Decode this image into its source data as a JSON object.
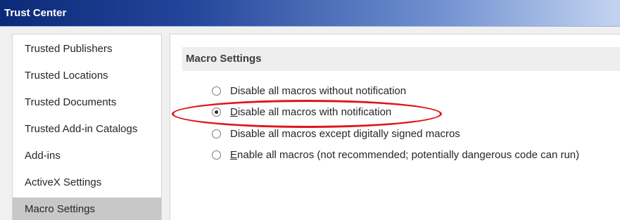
{
  "window": {
    "title": "Trust Center"
  },
  "sidebar": {
    "items": [
      {
        "label": "Trusted Publishers",
        "selected": false
      },
      {
        "label": "Trusted Locations",
        "selected": false
      },
      {
        "label": "Trusted Documents",
        "selected": false
      },
      {
        "label": "Trusted Add-in Catalogs",
        "selected": false
      },
      {
        "label": "Add-ins",
        "selected": false
      },
      {
        "label": "ActiveX Settings",
        "selected": false
      },
      {
        "label": "Macro Settings",
        "selected": true
      }
    ]
  },
  "main": {
    "section_title": "Macro Settings",
    "options": [
      {
        "access_key": "",
        "label_underlined": "",
        "label_rest": "Disable all macros without notification",
        "checked": false
      },
      {
        "access_key": "D",
        "label_underlined": "D",
        "label_rest": "isable all macros with notification",
        "checked": true
      },
      {
        "access_key": "",
        "label_underlined": "",
        "label_rest": "Disable all macros except digitally signed macros",
        "checked": false
      },
      {
        "access_key": "E",
        "label_underlined": "E",
        "label_rest": "nable all macros (not recommended; potentially dangerous code can run)",
        "checked": false
      }
    ]
  },
  "annotation": {
    "color": "#e0161a",
    "shape": "ellipse",
    "target": "Disable all macros with notification"
  }
}
